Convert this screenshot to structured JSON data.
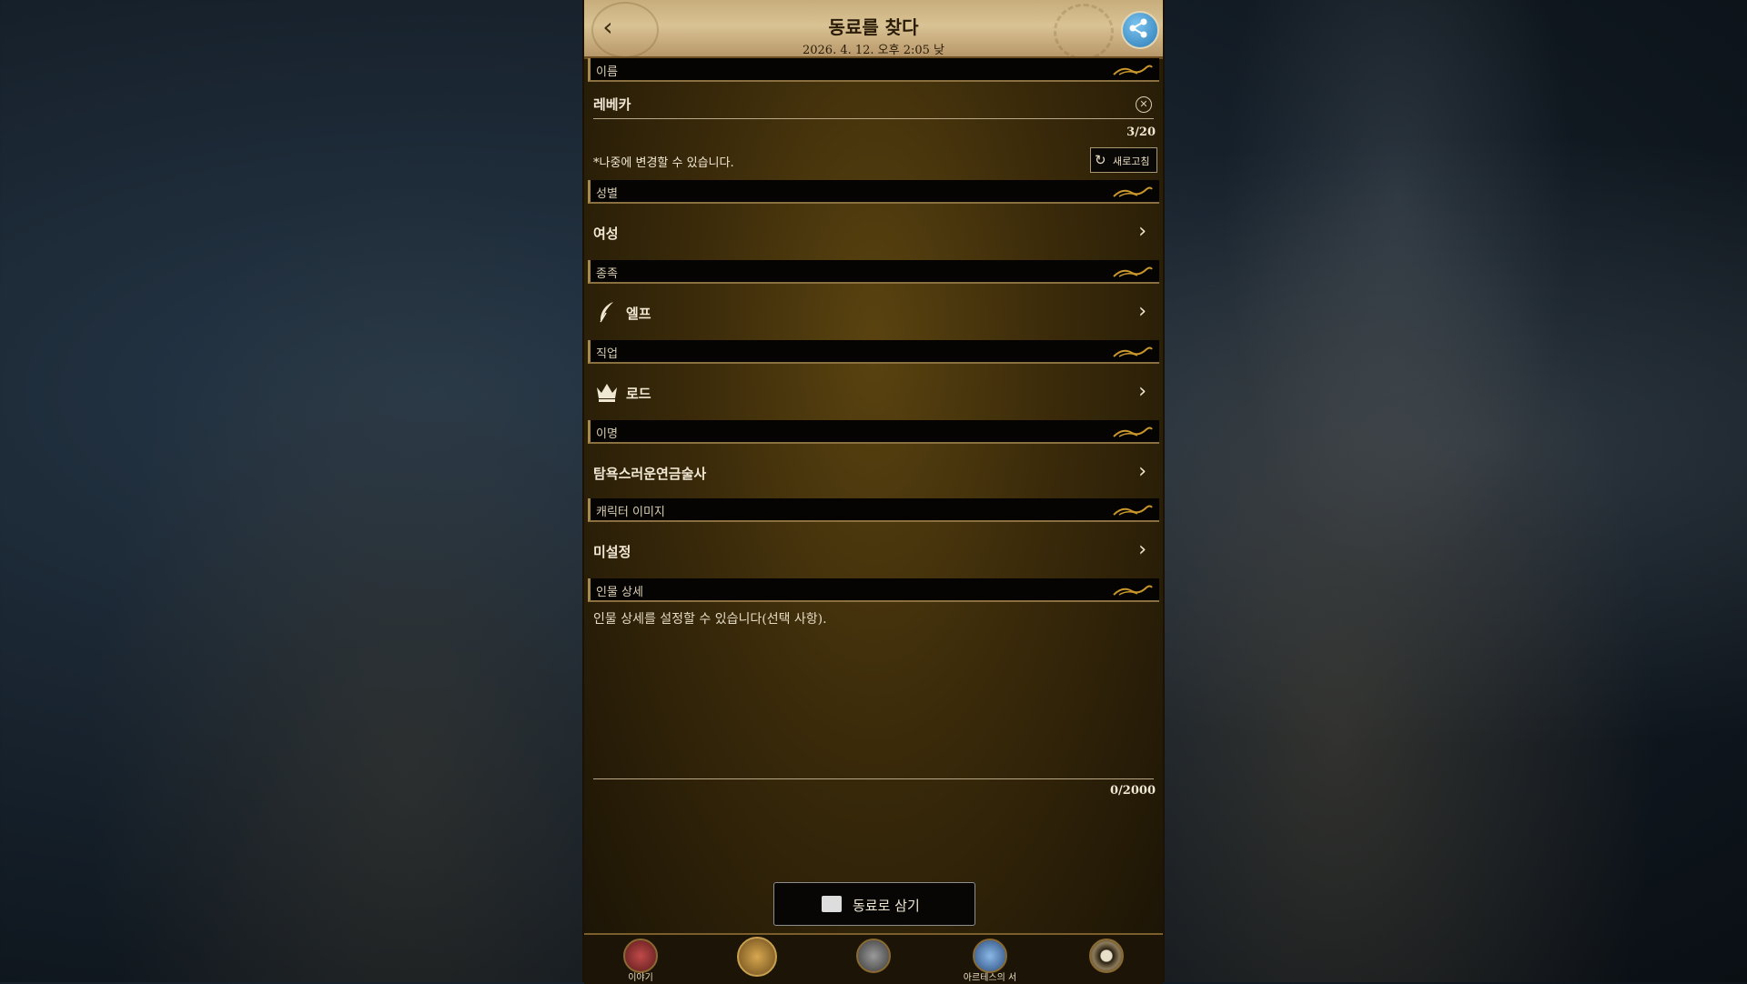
{
  "header": {
    "title": "동료를 찾다",
    "subtitle": "2026. 4. 12. 오후 2:05 낮",
    "back_icon": "chevron-left-icon",
    "share_icon": "share-icon"
  },
  "name_section": {
    "label": "이름",
    "value": "레베카",
    "counter": "3/20",
    "note": "*나중에 변경할 수 있습니다.",
    "refresh_label": "새로고침"
  },
  "gender_section": {
    "label": "성별",
    "value": "여성"
  },
  "race_section": {
    "label": "종족",
    "value": "엘프",
    "icon": "feather-icon"
  },
  "class_section": {
    "label": "직업",
    "value": "로드",
    "icon": "crown-icon"
  },
  "alias_section": {
    "label": "이명",
    "value": "탐욕스러운연금술사"
  },
  "image_section": {
    "label": "캐릭터 이미지",
    "value": "미설정"
  },
  "detail_section": {
    "label": "인물 상세",
    "placeholder": "인물 상세를 설정할 수 있습니다(선택 사항).",
    "counter": "0/2000"
  },
  "confirm_button": {
    "label": "동료로 삼기",
    "icon": "scroll-card-icon"
  },
  "bottom_nav": [
    {
      "label": "이야기",
      "icon": "story-icon",
      "color": "#8a2a2a"
    },
    {
      "label": "",
      "icon": "emblem-icon",
      "color": "#a8782a"
    },
    {
      "label": "",
      "icon": "horse-icon",
      "color": "#6a6a6a"
    },
    {
      "label": "아르테스의 서",
      "icon": "book-icon",
      "color": "#3a6aa0"
    },
    {
      "label": "",
      "icon": "gear-icon",
      "color": "#5a4a2a"
    }
  ],
  "colors": {
    "panel_bg": "#3a2a0a",
    "header_band": "#050403",
    "accent_gold": "#a88a4a",
    "share_blue": "#2a7bb6"
  }
}
